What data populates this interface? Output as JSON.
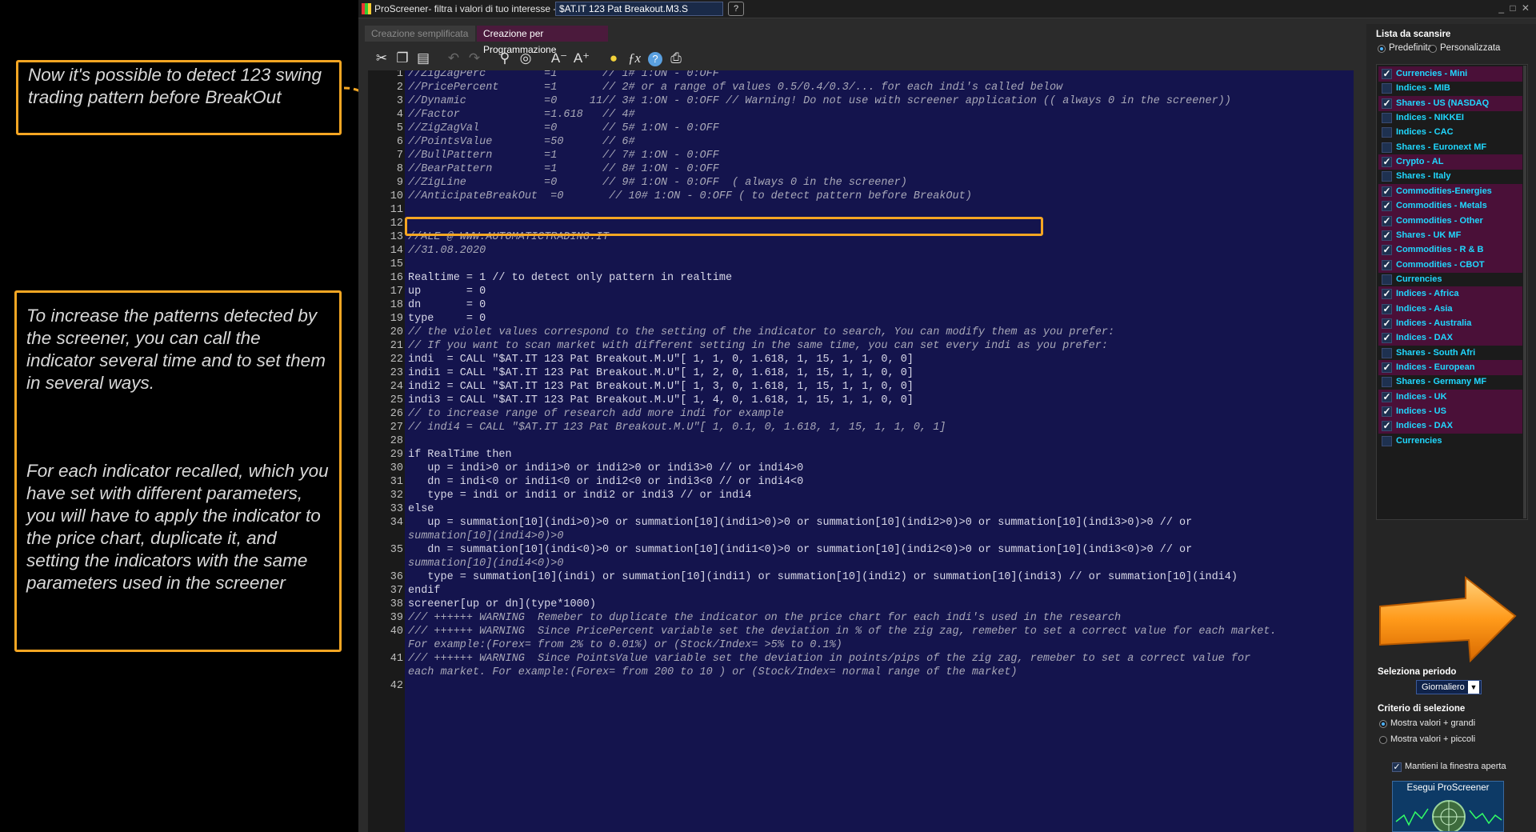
{
  "annotations": {
    "top_note": "Now it's possible to detect 123 swing trading pattern before BreakOut",
    "middle_note_p1": "To increase the patterns detected by the screener,  you can call  the indicator several time and to set them in several ways.",
    "middle_note_p2": "For each indicator recalled, which you have set with different parameters, you will have to apply the indicator to the price chart, duplicate it, and setting the indicators  with the same parameters used in the screener"
  },
  "window": {
    "title": "ProScreener- filtra i valori di tuo interesse -",
    "file_name": "$AT.IT 123 Pat Breakout.M3.S",
    "controls": "_ □ ✕"
  },
  "tabs": [
    {
      "label": "Creazione semplificata",
      "active": false
    },
    {
      "label": "Creazione per Programmazione",
      "active": true
    }
  ],
  "toolbar": {
    "icons": [
      "cut-icon",
      "copy-icon",
      "paste-icon",
      "undo-icon",
      "redo-icon",
      "search-icon",
      "find-replace-icon",
      "font-decrease-icon",
      "font-increase-icon",
      "bulb-icon",
      "function-icon",
      "help-icon",
      "print-icon"
    ],
    "font_decrease": "A⁻",
    "font_increase": "A⁺"
  },
  "code_lines": [
    {
      "n": "1",
      "t": "//ZigZagPerc         =1       // 1# 1:ON - 0:OFF",
      "c": "cm"
    },
    {
      "n": "2",
      "t": "//PricePercent       =1       // 2# or a range of values 0.5/0.4/0.3/... for each indi's called below",
      "c": "cm"
    },
    {
      "n": "3",
      "t": "//Dynamic            =0     11// 3# 1:ON - 0:OFF // Warning! Do not use with screener application (( always 0 in the screener))",
      "c": "cm"
    },
    {
      "n": "4",
      "t": "//Factor             =1.618   // 4#",
      "c": "cm"
    },
    {
      "n": "5",
      "t": "//ZigZagVal          =0       // 5# 1:ON - 0:OFF",
      "c": "cm"
    },
    {
      "n": "6",
      "t": "//PointsValue        =50      // 6#",
      "c": "cm"
    },
    {
      "n": "7",
      "t": "//BullPattern        =1       // 7# 1:ON - 0:OFF",
      "c": "cm"
    },
    {
      "n": "8",
      "t": "//BearPattern        =1       // 8# 1:ON - 0:OFF",
      "c": "cm"
    },
    {
      "n": "9",
      "t": "//ZigLine            =0       // 9# 1:ON - 0:OFF  ( always 0 in the screener)",
      "c": "cm"
    },
    {
      "n": "10",
      "t": "//AnticipateBreakOut  =0       // 10# 1:ON - 0:OFF ( to detect pattern before BreakOut)",
      "c": "cm"
    },
    {
      "n": "11",
      "t": "",
      "c": ""
    },
    {
      "n": "12",
      "t": "",
      "c": ""
    },
    {
      "n": "13",
      "t": "//ALE @ WWW.AUTOMATICTRADING.IT",
      "c": "cm"
    },
    {
      "n": "14",
      "t": "//31.08.2020",
      "c": "cm"
    },
    {
      "n": "15",
      "t": "",
      "c": ""
    },
    {
      "n": "16",
      "t": "Realtime = 1 // to detect only pattern in realtime",
      "c": ""
    },
    {
      "n": "17",
      "t": "up       = 0",
      "c": ""
    },
    {
      "n": "18",
      "t": "dn       = 0",
      "c": ""
    },
    {
      "n": "19",
      "t": "type     = 0",
      "c": ""
    },
    {
      "n": "20",
      "t": "// the violet values correspond to the setting of the indicator to search, You can modify them as you prefer:",
      "c": "cm"
    },
    {
      "n": "21",
      "t": "// If you want to scan market with different setting in the same time, you can set every indi as you prefer:",
      "c": "cm"
    },
    {
      "n": "22",
      "t": "indi  = CALL \"$AT.IT 123 Pat Breakout.M.U\"[ 1, 1, 0, 1.618, 1, 15, 1, 1, 0, 0]",
      "c": ""
    },
    {
      "n": "23",
      "t": "indi1 = CALL \"$AT.IT 123 Pat Breakout.M.U\"[ 1, 2, 0, 1.618, 1, 15, 1, 1, 0, 0]",
      "c": ""
    },
    {
      "n": "24",
      "t": "indi2 = CALL \"$AT.IT 123 Pat Breakout.M.U\"[ 1, 3, 0, 1.618, 1, 15, 1, 1, 0, 0]",
      "c": ""
    },
    {
      "n": "25",
      "t": "indi3 = CALL \"$AT.IT 123 Pat Breakout.M.U\"[ 1, 4, 0, 1.618, 1, 15, 1, 1, 0, 0]",
      "c": ""
    },
    {
      "n": "26",
      "t": "// to increase range of research add more indi for example",
      "c": "cm"
    },
    {
      "n": "27",
      "t": "// indi4 = CALL \"$AT.IT 123 Pat Breakout.M.U\"[ 1, 0.1, 0, 1.618, 1, 15, 1, 1, 0, 1]",
      "c": "cm"
    },
    {
      "n": "28",
      "t": "",
      "c": ""
    },
    {
      "n": "29",
      "t": "if RealTime then",
      "c": ""
    },
    {
      "n": "30",
      "t": "   up = indi>0 or indi1>0 or indi2>0 or indi3>0 // or indi4>0",
      "c": ""
    },
    {
      "n": "31",
      "t": "   dn = indi<0 or indi1<0 or indi2<0 or indi3<0 // or indi4<0",
      "c": ""
    },
    {
      "n": "32",
      "t": "   type = indi or indi1 or indi2 or indi3 // or indi4",
      "c": ""
    },
    {
      "n": "33",
      "t": "else",
      "c": ""
    },
    {
      "n": "34",
      "t": "   up = summation[10](indi>0)>0 or summation[10](indi1>0)>0 or summation[10](indi2>0)>0 or summation[10](indi3>0)>0 // or",
      "c": ""
    },
    {
      "n": "",
      "t": "summation[10](indi4>0)>0",
      "c": "cm"
    },
    {
      "n": "35",
      "t": "   dn = summation[10](indi<0)>0 or summation[10](indi1<0)>0 or summation[10](indi2<0)>0 or summation[10](indi3<0)>0 // or",
      "c": ""
    },
    {
      "n": "",
      "t": "summation[10](indi4<0)>0",
      "c": "cm"
    },
    {
      "n": "36",
      "t": "   type = summation[10](indi) or summation[10](indi1) or summation[10](indi2) or summation[10](indi3) // or summation[10](indi4)",
      "c": ""
    },
    {
      "n": "37",
      "t": "endif",
      "c": ""
    },
    {
      "n": "38",
      "t": "screener[up or dn](type*1000)",
      "c": ""
    },
    {
      "n": "39",
      "t": "/// ++++++ WARNING  Remeber to duplicate the indicator on the price chart for each indi's used in the research",
      "c": "cm"
    },
    {
      "n": "40",
      "t": "/// ++++++ WARNING  Since PricePercent variable set the deviation in % of the zig zag, remeber to set a correct value for each market.",
      "c": "cm"
    },
    {
      "n": "",
      "t": "For example:(Forex= from 2% to 0.01%) or (Stock/Index= >5% to 0.1%)",
      "c": "cm"
    },
    {
      "n": "41",
      "t": "/// ++++++ WARNING  Since PointsValue variable set the deviation in points/pips of the zig zag, remeber to set a correct value for",
      "c": "cm"
    },
    {
      "n": "",
      "t": "each market. For example:(Forex= from 200 to 10 ) or (Stock/Index= normal range of the market)",
      "c": "cm"
    },
    {
      "n": "42",
      "t": "",
      "c": ""
    }
  ],
  "right_panel": {
    "list_title": "Lista da scansire",
    "radio_predef": "Predefinita",
    "radio_custom": "Personalizzata",
    "items": [
      {
        "label": "Currencies - Mini",
        "checked": true
      },
      {
        "label": "Indices - MIB",
        "checked": false
      },
      {
        "label": "Shares - US (NASDAQ",
        "checked": true
      },
      {
        "label": "Indices - NIKKEI",
        "checked": false
      },
      {
        "label": "Indices - CAC",
        "checked": false
      },
      {
        "label": "Shares - Euronext MF",
        "checked": false
      },
      {
        "label": "Crypto - AL",
        "checked": true
      },
      {
        "label": "Shares - Italy",
        "checked": false
      },
      {
        "label": "Commodities-Energies",
        "checked": true
      },
      {
        "label": "Commodities - Metals",
        "checked": true
      },
      {
        "label": "Commodities - Other",
        "checked": true
      },
      {
        "label": "Shares - UK MF",
        "checked": true
      },
      {
        "label": "Commodities - R & B",
        "checked": true
      },
      {
        "label": "Commodities - CBOT",
        "checked": true
      },
      {
        "label": "Currencies",
        "checked": false
      },
      {
        "label": "Indices - Africa",
        "checked": true
      },
      {
        "label": "Indices - Asia",
        "checked": true
      },
      {
        "label": "Indices - Australia",
        "checked": true
      },
      {
        "label": "Indices - DAX",
        "checked": true
      },
      {
        "label": "Shares - South Afri",
        "checked": false
      },
      {
        "label": "Indices - European",
        "checked": true
      },
      {
        "label": "Shares - Germany MF",
        "checked": false
      },
      {
        "label": "Indices - UK",
        "checked": true
      },
      {
        "label": "Indices - US",
        "checked": true
      },
      {
        "label": "Indices - DAX",
        "checked": true
      },
      {
        "label": "Currencies",
        "checked": false
      }
    ],
    "period_label": "Seleziona periodo",
    "period_value": "Giornaliero",
    "criteria_label": "Criterio di selezione",
    "criteria_high": "Mostra valori + grandi",
    "criteria_low": "Mostra valori + piccoli",
    "keep_open": "Mantieni la finestra aperta",
    "run_button": "Esegui ProScreener"
  },
  "colors": {
    "accent_orange": "#f5a623",
    "editor_bg": "#14144d",
    "list_checked_bg": "#4a1038",
    "list_text": "#20d8ff"
  }
}
